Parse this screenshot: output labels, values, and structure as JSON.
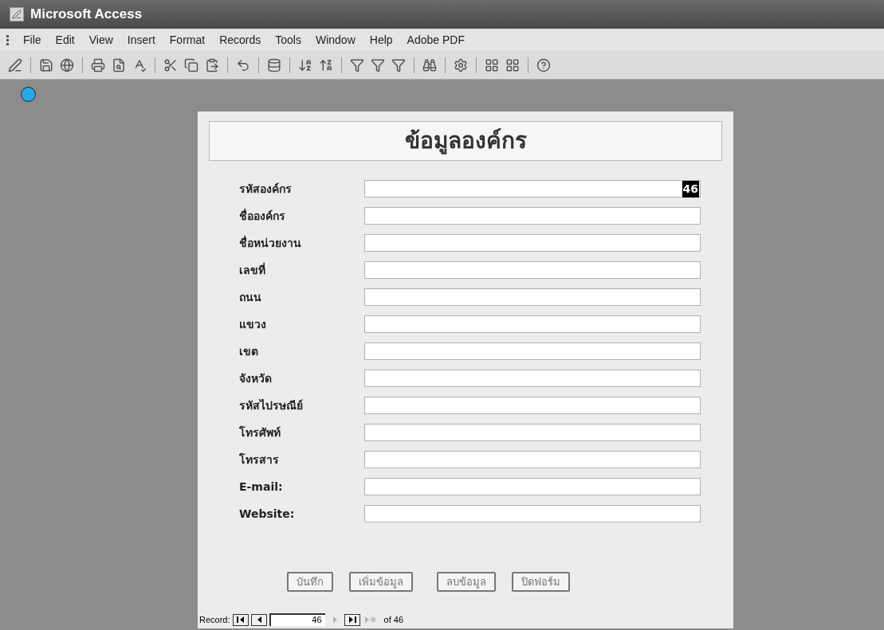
{
  "window": {
    "title": "Microsoft Access"
  },
  "menu": [
    {
      "label": "File"
    },
    {
      "label": "Edit"
    },
    {
      "label": "View"
    },
    {
      "label": "Insert"
    },
    {
      "label": "Format"
    },
    {
      "label": "Records"
    },
    {
      "label": "Tools"
    },
    {
      "label": "Window"
    },
    {
      "label": "Help"
    },
    {
      "label": "Adobe PDF"
    }
  ],
  "form": {
    "title": "ข้อมูลองค์กร",
    "fields": [
      {
        "label": "รหัสองค์กร",
        "value": "46",
        "value_selected": true
      },
      {
        "label": "ชื่อองค์กร"
      },
      {
        "label": "ชื่อหน่วยงาน"
      },
      {
        "label": "เลขที่"
      },
      {
        "label": "ถนน"
      },
      {
        "label": "แขวง"
      },
      {
        "label": "เขต"
      },
      {
        "label": "จังหวัด"
      },
      {
        "label": "รหัสไปรษณีย์"
      },
      {
        "label": "โทรศัพท์"
      },
      {
        "label": "โทรสาร"
      },
      {
        "label": "E-mail:"
      },
      {
        "label": "Website:"
      }
    ],
    "buttons": [
      "บันทึก",
      "เพิ่มข้อมูล",
      "ลบข้อมูล",
      "ปิดฟอร์ม"
    ]
  },
  "record_nav": {
    "label": "Record:",
    "current": "46",
    "total_text": "of 46",
    "buttons": [
      {
        "kind": "first",
        "disabled": false
      },
      {
        "kind": "prev",
        "disabled": false
      },
      {
        "kind": "next",
        "disabled": true
      },
      {
        "kind": "last",
        "disabled": false
      },
      {
        "kind": "new",
        "disabled": true
      }
    ]
  }
}
